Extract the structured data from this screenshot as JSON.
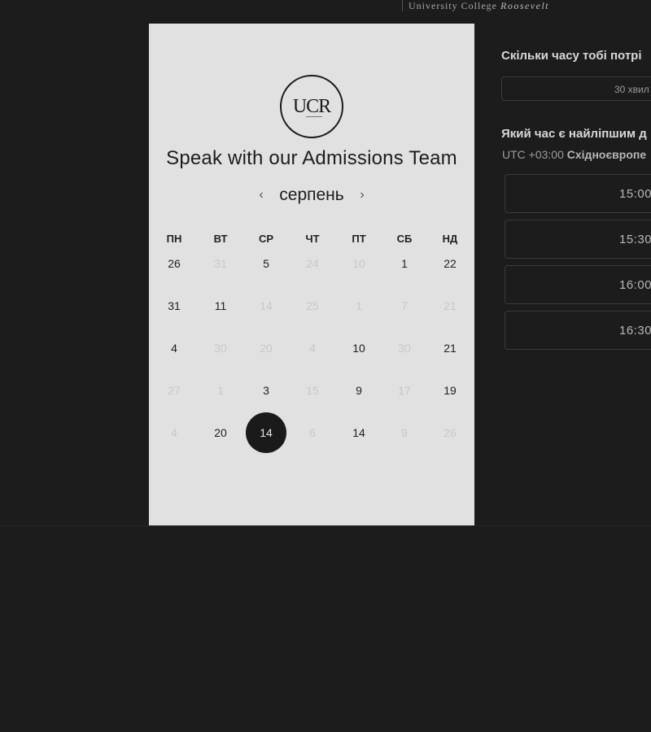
{
  "header": {
    "logo_text": "University College ",
    "logo_text_italic": "Roosevelt"
  },
  "card": {
    "logo_initials": "UCR",
    "title": "Speak with our Admissions Team",
    "month": "серпень",
    "prev_icon": "chevron-left-icon",
    "next_icon": "chevron-right-icon",
    "prev_glyph": "‹",
    "next_glyph": "›",
    "weekdays": [
      "ПН",
      "ВТ",
      "СР",
      "ЧТ",
      "ПТ",
      "СБ",
      "НД"
    ],
    "weeks": [
      [
        {
          "d": "26",
          "m": false
        },
        {
          "d": "31",
          "m": true
        },
        {
          "d": "5",
          "m": false
        },
        {
          "d": "24",
          "m": true
        },
        {
          "d": "10",
          "m": true
        },
        {
          "d": "1",
          "m": false
        },
        {
          "d": "22",
          "m": false
        }
      ],
      [
        {
          "d": "31",
          "m": false
        },
        {
          "d": "11",
          "m": false
        },
        {
          "d": "14",
          "m": true
        },
        {
          "d": "25",
          "m": true
        },
        {
          "d": "1",
          "m": true
        },
        {
          "d": "7",
          "m": true
        },
        {
          "d": "21",
          "m": true
        }
      ],
      [
        {
          "d": "4",
          "m": false
        },
        {
          "d": "30",
          "m": true
        },
        {
          "d": "20",
          "m": true
        },
        {
          "d": "4",
          "m": true
        },
        {
          "d": "10",
          "m": false
        },
        {
          "d": "30",
          "m": true
        },
        {
          "d": "21",
          "m": false
        }
      ],
      [
        {
          "d": "27",
          "m": true
        },
        {
          "d": "1",
          "m": true
        },
        {
          "d": "3",
          "m": false
        },
        {
          "d": "15",
          "m": true
        },
        {
          "d": "9",
          "m": false
        },
        {
          "d": "17",
          "m": true
        },
        {
          "d": "19",
          "m": false
        }
      ],
      [
        {
          "d": "4",
          "m": true
        },
        {
          "d": "20",
          "m": false
        },
        {
          "d": "14",
          "m": false,
          "s": true
        },
        {
          "d": "6",
          "m": true
        },
        {
          "d": "14",
          "m": false
        },
        {
          "d": "9",
          "m": true
        },
        {
          "d": "26",
          "m": true
        }
      ]
    ],
    "colors": {
      "panel_bg": "#e1e1e1",
      "selected_bg": "#1a1a1a",
      "page_bg": "#1c1c1c"
    }
  },
  "scheduler": {
    "duration_question": "Скільки часу тобі потрі",
    "duration_value": "30 хвил",
    "time_question": "Який час є найліпшим д",
    "timezone_prefix": "UTC +03:00 ",
    "timezone_name": "Східноєвропе",
    "slots": [
      "15:00",
      "15:30",
      "16:00",
      "16:30"
    ]
  }
}
